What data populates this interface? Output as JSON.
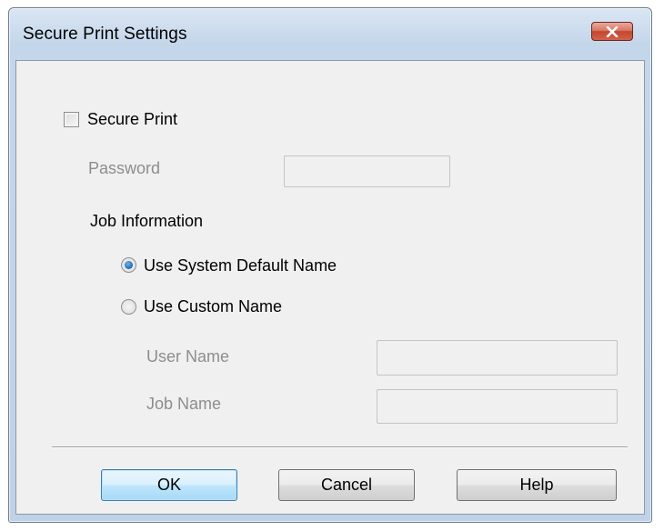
{
  "dialog": {
    "title": "Secure Print Settings",
    "close_icon": "close-icon"
  },
  "secure_print": {
    "label": "Secure Print",
    "checked": false
  },
  "password": {
    "label": "Password",
    "value": ""
  },
  "job_information": {
    "heading": "Job Information",
    "options": [
      {
        "label": "Use System Default Name",
        "selected": true
      },
      {
        "label": "Use Custom Name",
        "selected": false
      }
    ],
    "user_name": {
      "label": "User Name",
      "value": ""
    },
    "job_name": {
      "label": "Job Name",
      "value": ""
    }
  },
  "buttons": {
    "ok": "OK",
    "cancel": "Cancel",
    "help": "Help"
  },
  "colors": {
    "frame": "#c4d6ea",
    "client": "#f0f0f0",
    "close_button": "#c4472f",
    "default_button_border": "#3c7fb1",
    "disabled_text": "#8d8d8d"
  }
}
